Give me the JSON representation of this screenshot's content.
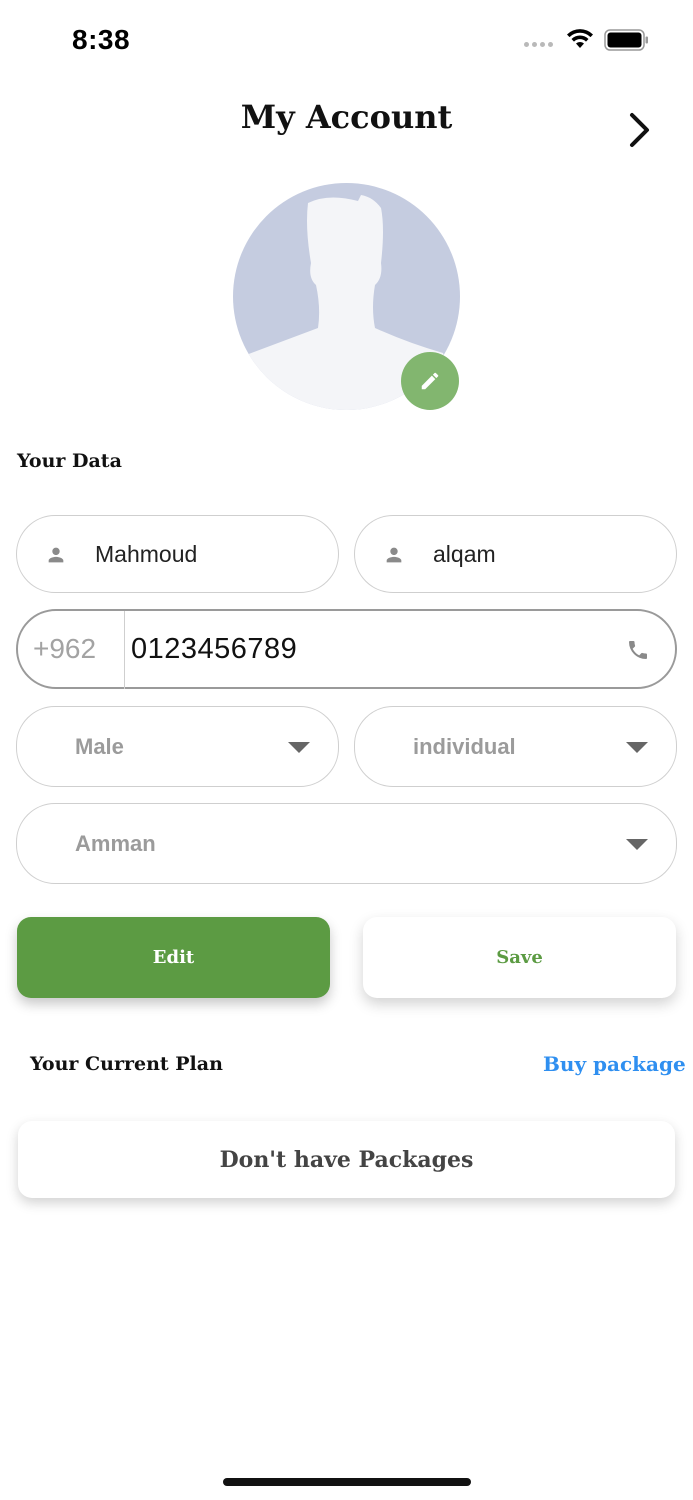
{
  "status_bar": {
    "time": "8:38"
  },
  "header": {
    "title": "My Account"
  },
  "sections": {
    "your_data": "Your Data",
    "current_plan": "Your Current Plan"
  },
  "form": {
    "first_name": "Mahmoud",
    "last_name": "alqam",
    "phone_prefix": "+962",
    "phone": "0123456789",
    "gender": "Male",
    "account_type": "individual",
    "city": "Amman"
  },
  "buttons": {
    "edit": "Edit",
    "save": "Save",
    "buy_package": "Buy package"
  },
  "plan": {
    "empty_message": "Don't have Packages"
  },
  "colors": {
    "primary_green": "#5c9b43",
    "link_blue": "#2f8ff0",
    "avatar_bg": "#c5cce0"
  }
}
